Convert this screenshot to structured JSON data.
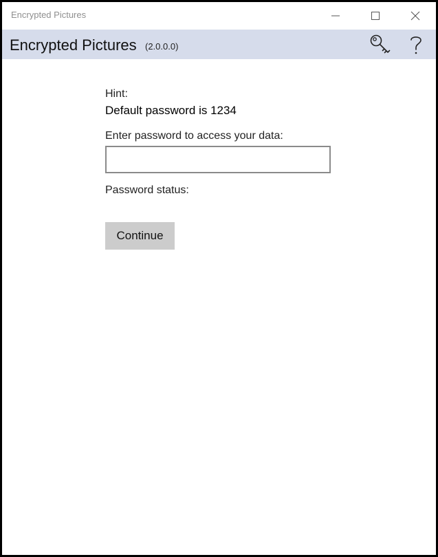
{
  "window": {
    "title": "Encrypted Pictures",
    "controls": {
      "minimize_icon": "minimize-icon",
      "maximize_icon": "maximize-icon",
      "close_icon": "close-icon"
    }
  },
  "app_header": {
    "title": "Encrypted Pictures",
    "version": "(2.0.0.0)",
    "background_color": "#d6dceb",
    "actions": [
      {
        "icon": "key-icon"
      },
      {
        "icon": "help-icon",
        "glyph": "?"
      }
    ]
  },
  "login": {
    "hint_label": "Hint:",
    "hint_text": "Default password is 1234",
    "password_label": "Enter password to access your data:",
    "password_value": "",
    "status_label": "Password status:",
    "continue_label": "Continue"
  }
}
